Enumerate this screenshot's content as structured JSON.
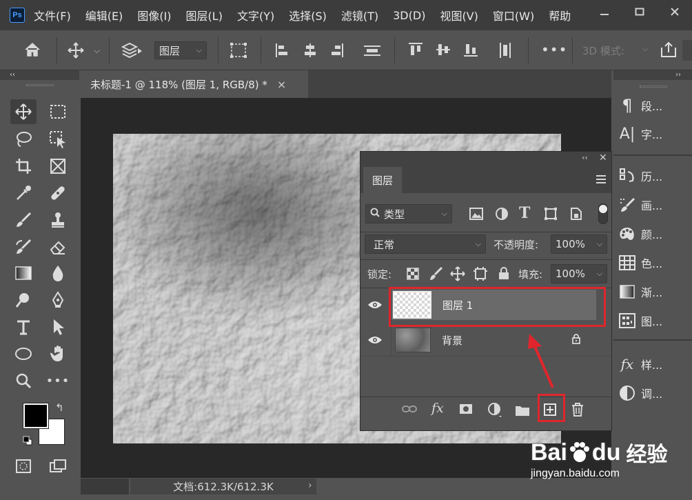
{
  "app": {
    "logo_text": "Ps"
  },
  "menu": [
    "文件(F)",
    "编辑(E)",
    "图像(I)",
    "图层(L)",
    "文字(Y)",
    "选择(S)",
    "滤镜(T)",
    "3D(D)",
    "视图(V)",
    "窗口(W)",
    "帮助"
  ],
  "options_bar": {
    "auto_select_target": "图层",
    "mode_3d_label": "3D 模式:"
  },
  "document_tab": {
    "title": "未标题-1 @ 118% (图层 1, RGB/8) *",
    "close": "×"
  },
  "status": {
    "doc_size": "文档:612.3K/612.3K"
  },
  "right_dock": {
    "group1": [
      {
        "icon": "pilcrow-icon",
        "glyph": "¶",
        "label": "段..."
      },
      {
        "icon": "type-icon",
        "glyph": "A|",
        "label": "字..."
      }
    ],
    "group2": [
      {
        "icon": "history-icon",
        "label": "历..."
      },
      {
        "icon": "brush-settings-icon",
        "label": "画..."
      },
      {
        "icon": "palette-icon",
        "label": "颜..."
      },
      {
        "icon": "swatches-icon",
        "label": "色..."
      },
      {
        "icon": "gradient-icon",
        "label": "渐..."
      },
      {
        "icon": "pattern-icon",
        "label": "图..."
      }
    ],
    "group3": [
      {
        "icon": "fx-icon",
        "label": "样..."
      },
      {
        "icon": "adjustments-icon",
        "label": "调..."
      }
    ]
  },
  "layers_panel": {
    "tab": "图层",
    "filter_kind": "类型",
    "blend_mode": "正常",
    "opacity_label": "不透明度:",
    "opacity_value": "100%",
    "lock_label": "锁定:",
    "fill_label": "填充:",
    "fill_value": "100%",
    "layers": [
      {
        "name": "图层 1",
        "visible": true,
        "selected": true
      },
      {
        "name": "背景",
        "visible": true,
        "locked": true
      }
    ]
  },
  "watermark": {
    "brand": "Bai",
    "brand2": "du",
    "suffix": "经验",
    "url": "jingyan.baidu.com"
  },
  "colors": {
    "menubar": "#3c3c3c",
    "panel": "#535353",
    "canvas_bg": "#282828",
    "highlight": "#e0262c",
    "selected_layer": "#6a6a6a"
  }
}
